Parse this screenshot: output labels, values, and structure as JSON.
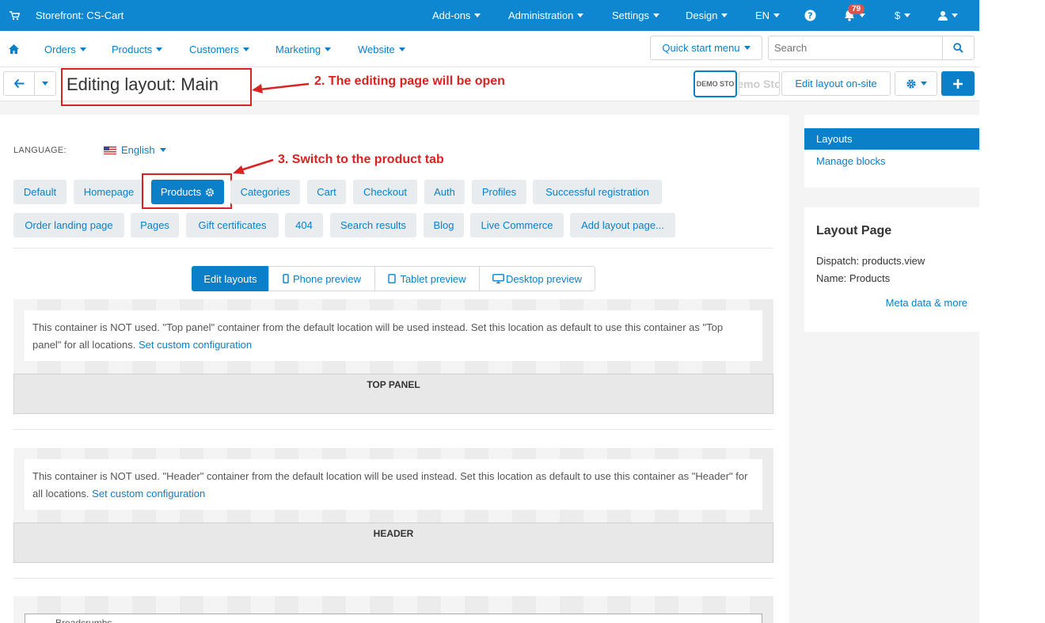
{
  "topbar": {
    "brand": "Storefront: CS-Cart",
    "menus": [
      "Add-ons",
      "Administration",
      "Settings",
      "Design"
    ],
    "language": "EN",
    "notifications_count": "79",
    "currency": "$"
  },
  "nav": {
    "items": [
      "Orders",
      "Products",
      "Customers",
      "Marketing",
      "Website"
    ],
    "quick_start": "Quick start menu",
    "search_placeholder": "Search"
  },
  "titlebar": {
    "title": "Editing layout: Main",
    "demo_logo_text": "DEMO STO",
    "demo_logo2_text": "emo Sto",
    "edit_onsite": "Edit layout on-site"
  },
  "annotations": {
    "step2": "2. The editing page will be open",
    "step3": "3. Switch to the product tab"
  },
  "language": {
    "label": "LANGUAGE:",
    "value": "English"
  },
  "tabs_row1": [
    "Default",
    "Homepage",
    "Products",
    "Categories",
    "Cart",
    "Checkout",
    "Auth",
    "Profiles",
    "Successful registration"
  ],
  "tabs_row2": [
    "Order landing page",
    "Pages",
    "Gift certificates",
    "404",
    "Search results",
    "Blog",
    "Live Commerce",
    "Add layout page..."
  ],
  "active_tab": "Products",
  "preview_modes": [
    "Edit layouts",
    "Phone preview",
    "Tablet preview",
    "Desktop preview"
  ],
  "containers": [
    {
      "notice": "This container is NOT used. \"Top panel\" container from the default location will be used instead. Set this location as default to use this container as \"Top panel\" for all locations.",
      "link": "Set custom configuration",
      "title": "TOP PANEL"
    },
    {
      "notice": "This container is NOT used. \"Header\" container from the default location will be used instead. Set this location as default to use this container as \"Header\" for all locations.",
      "link": "Set custom configuration",
      "title": "HEADER"
    }
  ],
  "breadcrumbs_block": "Breadcrumbs",
  "sidebar": {
    "menu": [
      "Layouts",
      "Manage blocks"
    ],
    "layout_page": {
      "title": "Layout Page",
      "dispatch": "Dispatch: products.view",
      "name": "Name: Products",
      "meta_link": "Meta data & more"
    }
  },
  "colors": {
    "primary": "#0b7fc7",
    "topbar": "#0f87d0",
    "annotation": "#d92323"
  }
}
